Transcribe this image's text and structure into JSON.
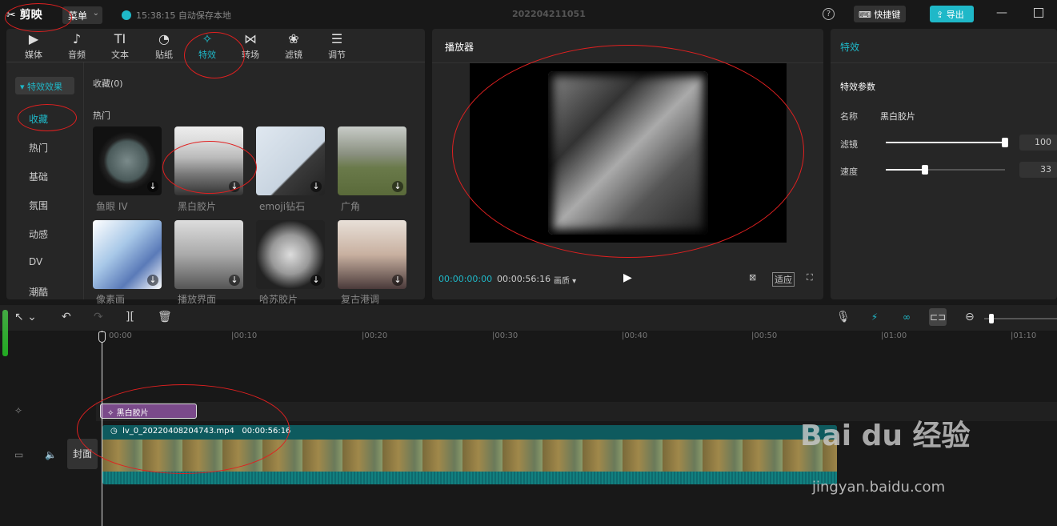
{
  "titlebar": {
    "app_name": "剪映",
    "menu_label": "菜单",
    "save_status": "15:38:15 自动保存本地",
    "project_name": "202204211051",
    "shortcut_label": "快捷键",
    "export_label": "导出"
  },
  "toolbar": {
    "tabs": [
      {
        "label": "媒体",
        "icon": "media-icon"
      },
      {
        "label": "音频",
        "icon": "audio-icon"
      },
      {
        "label": "文本",
        "icon": "text-icon"
      },
      {
        "label": "贴纸",
        "icon": "sticker-icon"
      },
      {
        "label": "特效",
        "icon": "effects-icon",
        "active": true
      },
      {
        "label": "转场",
        "icon": "transition-icon"
      },
      {
        "label": "滤镜",
        "icon": "filter-icon"
      },
      {
        "label": "调节",
        "icon": "adjust-icon"
      }
    ]
  },
  "sidebar": {
    "header": "特效效果",
    "items": [
      "收藏",
      "热门",
      "基础",
      "氛围",
      "动感",
      "DV",
      "潮酷"
    ]
  },
  "library": {
    "favorites_label": "收藏(0)",
    "hot_label": "热门",
    "effects": [
      "鱼眼 IV",
      "黑白胶片",
      "emoji钻石",
      "广角",
      "像素画",
      "播放界面",
      "哈苏胶片",
      "复古港调"
    ]
  },
  "player": {
    "title": "播放器",
    "current_time": "00:00:00:00",
    "total_time": "00:00:56:16",
    "quality_label": "画质",
    "fit_label": "适应"
  },
  "effect_panel": {
    "title": "特效",
    "section_title": "特效参数",
    "name_label": "名称",
    "name_value": "黑白胶片",
    "filter_label": "滤镜",
    "filter_value": "100",
    "filter_level": 1.0,
    "speed_label": "速度",
    "speed_value": "33",
    "speed_level": 0.33
  },
  "timeline": {
    "ruler": [
      "00:00",
      "|00:10",
      "|00:20",
      "|00:30",
      "|00:40",
      "|00:50",
      "|01:00",
      "|01:10"
    ],
    "effect_clip": "黑白胶片",
    "video_clip_name": "lv_0_20220408204743.mp4",
    "video_clip_duration": "00:00:56:16",
    "cover_label": "封面"
  },
  "watermark": {
    "brand": "Bai du 经验",
    "url": "jingyan.baidu.com"
  },
  "colors": {
    "accent": "#1fb8c8",
    "effect_clip": "#7a4a8a",
    "video_clip": "#0e6a6e",
    "annotation": "#e02020"
  }
}
